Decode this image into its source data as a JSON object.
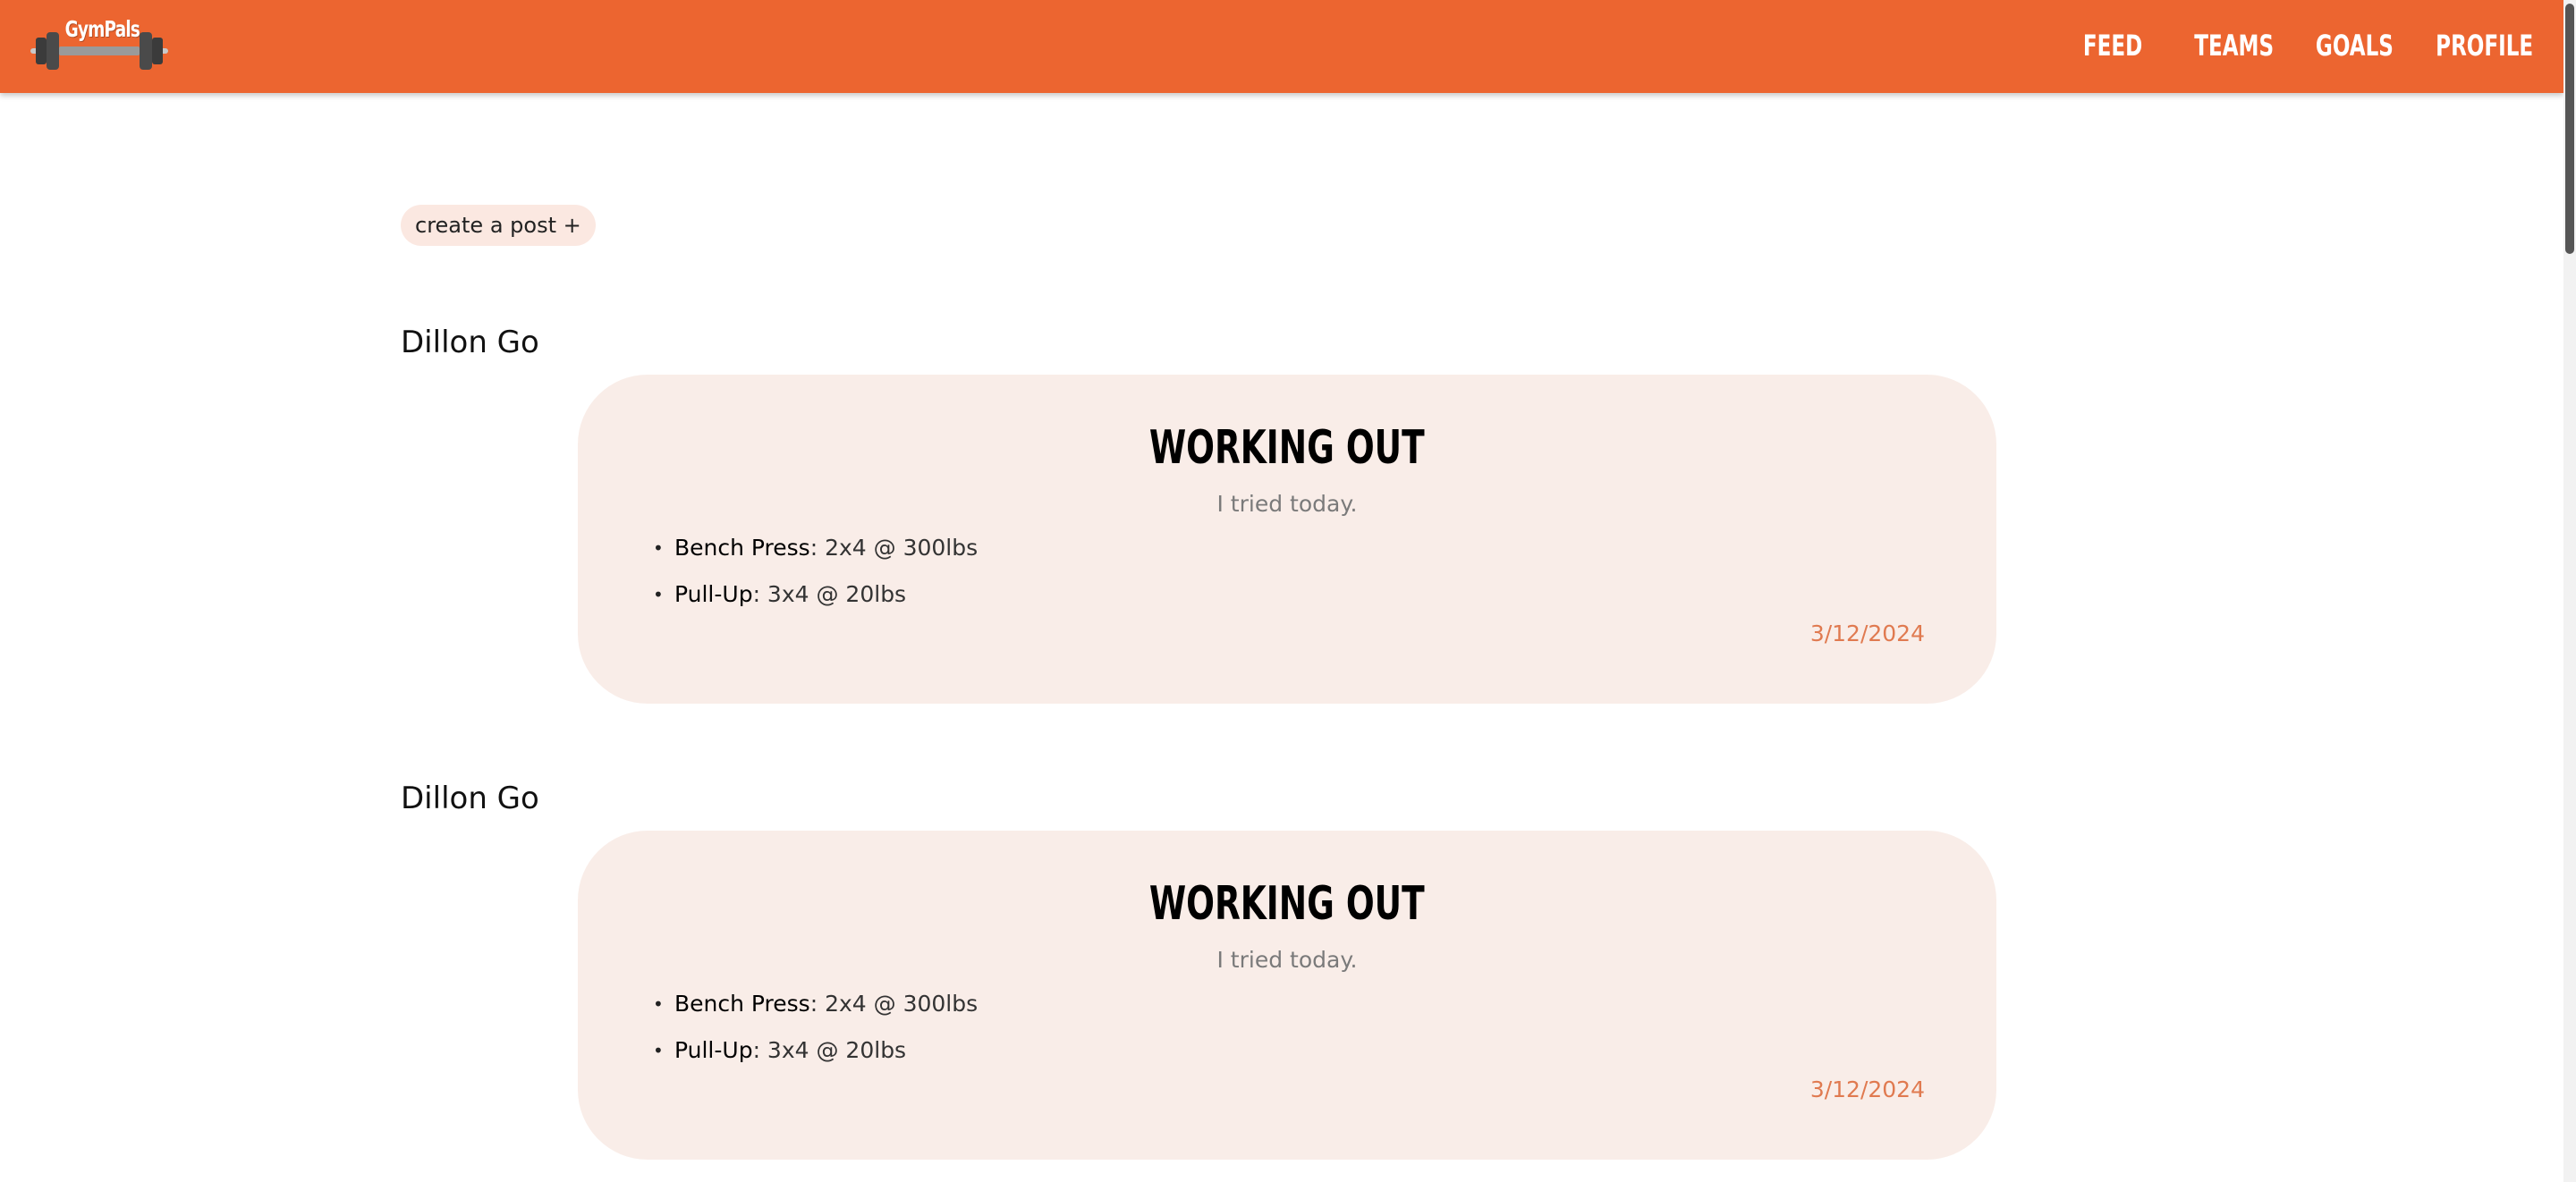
{
  "app": {
    "logo_text": "GymPals",
    "brand_color": "#ec6530"
  },
  "nav": {
    "items": [
      {
        "label": "FEED"
      },
      {
        "label": "TEAMS"
      },
      {
        "label": "GOALS"
      },
      {
        "label": "PROFILE"
      }
    ]
  },
  "feed": {
    "create_post_label": "create a post +",
    "posts": [
      {
        "author": "Dillon Go",
        "title": "WORKING OUT",
        "subtitle": "I tried today.",
        "exercises": [
          {
            "name": "Bench Press",
            "detail": ": 2x4 @ 300lbs"
          },
          {
            "name": "Pull-Up",
            "detail": ": 3x4 @ 20lbs"
          }
        ],
        "date": "3/12/2024"
      },
      {
        "author": "Dillon Go",
        "title": "WORKING OUT",
        "subtitle": "I tried today.",
        "exercises": [
          {
            "name": "Bench Press",
            "detail": ": 2x4 @ 300lbs"
          },
          {
            "name": "Pull-Up",
            "detail": ": 3x4 @ 20lbs"
          }
        ],
        "date": "3/12/2024"
      }
    ]
  },
  "colors": {
    "card_bg": "#f9ede8",
    "date": "#e07a50",
    "create_button_bg": "#fbe8e1"
  },
  "icons": {
    "logo": "barbell-icon"
  }
}
